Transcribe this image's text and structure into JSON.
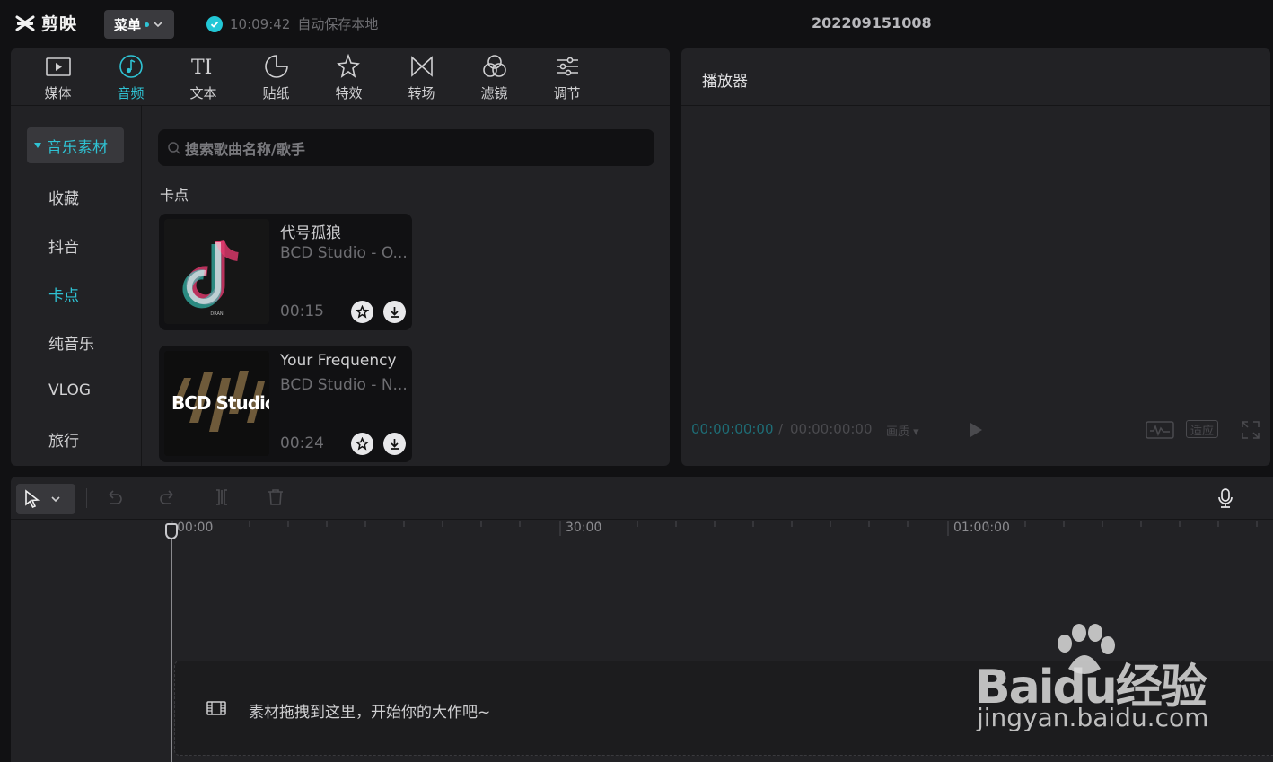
{
  "app": {
    "name": "剪映",
    "menu_label": "菜单"
  },
  "autosave": {
    "time": "10:09:42",
    "text": "自动保存本地"
  },
  "project": {
    "title": "202209151008"
  },
  "tool_tabs": [
    {
      "label": "媒体",
      "icon": "media-icon"
    },
    {
      "label": "音频",
      "icon": "audio-icon",
      "active": true
    },
    {
      "label": "文本",
      "icon": "text-icon"
    },
    {
      "label": "贴纸",
      "icon": "sticker-icon"
    },
    {
      "label": "特效",
      "icon": "effects-icon"
    },
    {
      "label": "转场",
      "icon": "transition-icon"
    },
    {
      "label": "滤镜",
      "icon": "filter-icon"
    },
    {
      "label": "调节",
      "icon": "adjust-icon"
    }
  ],
  "side_nav": [
    {
      "label": "音乐素材",
      "selected": true
    },
    {
      "label": "收藏"
    },
    {
      "label": "抖音"
    },
    {
      "label": "卡点",
      "active": true
    },
    {
      "label": "纯音乐"
    },
    {
      "label": "VLOG"
    },
    {
      "label": "旅行"
    }
  ],
  "search": {
    "placeholder": "搜索歌曲名称/歌手"
  },
  "section": {
    "title": "卡点"
  },
  "tracks": [
    {
      "title": "代号孤狼",
      "artist": "BCD Studio - O...",
      "duration": "00:15",
      "cover_caption": "DRAN"
    },
    {
      "title": "Your Frequency",
      "artist": "BCD Studio - N...",
      "duration": "00:24",
      "cover_caption": "BCD Studio"
    }
  ],
  "player": {
    "title": "播放器",
    "current_time": "00:00:00:00",
    "separator": "/",
    "total_time": "00:00:00:00",
    "quality_label": "画质",
    "fit_label": "适应"
  },
  "timeline": {
    "ruler_labels": [
      "00:00",
      "30:00",
      "01:00:00"
    ],
    "drop_hint": "素材拖拽到这里，开始你的大作吧~"
  },
  "watermark": {
    "brand": "Baidu经验",
    "url": "jingyan.baidu.com"
  },
  "colors": {
    "accent": "#2fc3d4",
    "panel": "#222225",
    "background": "#111113"
  }
}
